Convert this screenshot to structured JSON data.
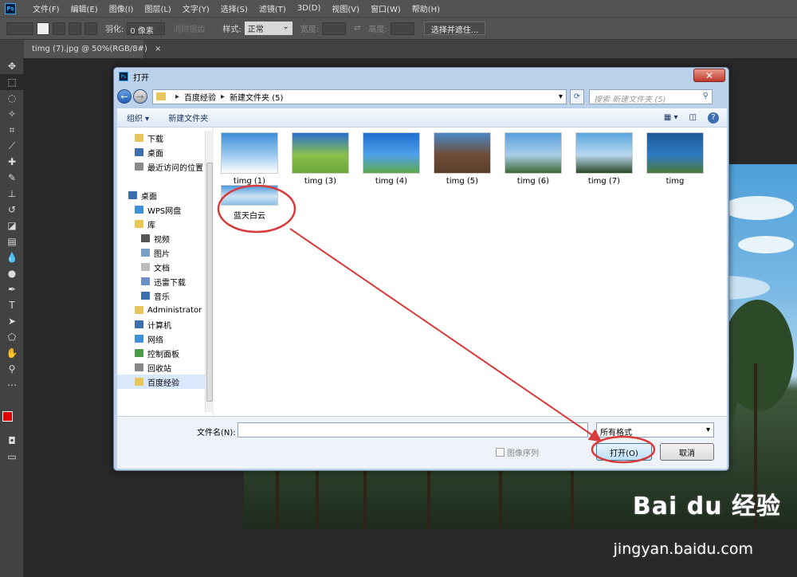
{
  "menubar": {
    "logo": "Ps",
    "items": [
      "文件(F)",
      "编辑(E)",
      "图像(I)",
      "图层(L)",
      "文字(Y)",
      "选择(S)",
      "滤镜(T)",
      "3D(D)",
      "视图(V)",
      "窗口(W)",
      "帮助(H)"
    ]
  },
  "options": {
    "feather_label": "羽化:",
    "feather_value": "0 像素",
    "antialias_label": "消除锯齿",
    "style_label": "样式:",
    "style_value": "正常",
    "width_label": "宽度:",
    "height_label": "高度:",
    "mask_button": "选择并遮住..."
  },
  "doc_tab": {
    "label": "timg (7).jpg @ 50%(RGB/8#)",
    "close": "×"
  },
  "watermark": {
    "brand": "Bai du 经验",
    "url": "jingyan.baidu.com"
  },
  "dialog": {
    "title": "打开",
    "close": "✕",
    "breadcrumb": [
      "百度经验",
      "新建文件夹 (5)"
    ],
    "search_placeholder": "搜索 新建文件夹 (5)",
    "toolbar": {
      "organize": "组织 ▾",
      "new_folder": "新建文件夹"
    },
    "nav": [
      {
        "label": "下载",
        "icon": "download-folder-icon",
        "indent": 1
      },
      {
        "label": "桌面",
        "icon": "desktop-icon",
        "indent": 1
      },
      {
        "label": "最近访问的位置",
        "icon": "recent-places-icon",
        "indent": 1
      },
      {
        "label": "",
        "icon": "",
        "indent": 0
      },
      {
        "label": "桌面",
        "icon": "desktop-icon",
        "indent": 0
      },
      {
        "label": "WPS网盘",
        "icon": "cloud-drive-icon",
        "indent": 1
      },
      {
        "label": "库",
        "icon": "library-icon",
        "indent": 1
      },
      {
        "label": "视频",
        "icon": "video-library-icon",
        "indent": 2
      },
      {
        "label": "图片",
        "icon": "picture-library-icon",
        "indent": 2
      },
      {
        "label": "文档",
        "icon": "document-library-icon",
        "indent": 2
      },
      {
        "label": "迅雷下载",
        "icon": "thunder-download-icon",
        "indent": 2
      },
      {
        "label": "音乐",
        "icon": "music-library-icon",
        "indent": 2
      },
      {
        "label": "Administrator",
        "icon": "user-folder-icon",
        "indent": 1
      },
      {
        "label": "计算机",
        "icon": "computer-icon",
        "indent": 1
      },
      {
        "label": "网络",
        "icon": "network-icon",
        "indent": 1
      },
      {
        "label": "控制面板",
        "icon": "control-panel-icon",
        "indent": 1
      },
      {
        "label": "回收站",
        "icon": "recycle-bin-icon",
        "indent": 1
      },
      {
        "label": "百度经验",
        "icon": "folder-icon",
        "indent": 1,
        "selected": true
      }
    ],
    "files": [
      {
        "name": "timg (1)",
        "colors": [
          "#3d8fd8",
          "#9cc9ef",
          "#ffffff"
        ]
      },
      {
        "name": "timg (3)",
        "colors": [
          "#2a6fd0",
          "#89c04a",
          "#6aa83a"
        ]
      },
      {
        "name": "timg (4)",
        "colors": [
          "#1f6fd0",
          "#4ea0e8",
          "#5ca84a"
        ]
      },
      {
        "name": "timg (5)",
        "colors": [
          "#4d88c8",
          "#6e4d36",
          "#5a3e2b"
        ]
      },
      {
        "name": "timg (6)",
        "colors": [
          "#5aa0dc",
          "#a8cde8",
          "#3e6b35"
        ]
      },
      {
        "name": "timg (7)",
        "colors": [
          "#5aa6e0",
          "#b8d8ef",
          "#2d4a28"
        ]
      },
      {
        "name": "timg",
        "colors": [
          "#1e5a9a",
          "#2f7ac2",
          "#4a7a3a"
        ]
      },
      {
        "name": "蓝天白云",
        "colors": [
          "#4a98dc",
          "#cfe3f4",
          "#8bbfe6"
        ]
      }
    ],
    "filename_label": "文件名(N):",
    "filename_value": "",
    "filter_value": "所有格式",
    "image_sequence": "图像序列",
    "open_button": "打开(O)",
    "cancel_button": "取消"
  }
}
